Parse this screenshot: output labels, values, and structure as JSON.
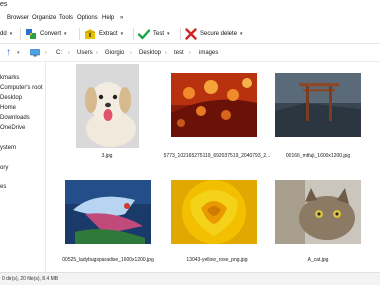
{
  "window": {
    "title": "es"
  },
  "menu": {
    "items": [
      "Browser",
      "Organize",
      "Tools",
      "Options",
      "Help"
    ],
    "overflow": "»"
  },
  "toolbar": {
    "add_label": "dd",
    "convert_label": "Convert",
    "extract_label": "Extract",
    "test_label": "Test",
    "secure_delete_label": "Secure delete",
    "caret": "▾"
  },
  "address": {
    "up_arrow": "↑",
    "drive": "C:",
    "segments": [
      "Users",
      "Giorgio",
      "Desktop",
      "test",
      "images"
    ],
    "separator": "›"
  },
  "sidebar": {
    "items": [
      "kmarks",
      "Computer's root",
      "Desktop",
      "Home",
      "Downloads",
      "OneDrive",
      "ystem",
      "ory",
      "es"
    ]
  },
  "files": [
    {
      "caption": "3.jpg",
      "thumb": "puppy"
    },
    {
      "caption": "5773_102165275119_692037519_2040793_2...",
      "thumb": "droplets"
    },
    {
      "caption": "00166_mtfuji_1600x1200.jpg",
      "thumb": "torii"
    },
    {
      "caption": "00525_ladybugsparadise_1600x1200.jpg",
      "thumb": "ladybug"
    },
    {
      "caption": "13043-yellow_rose_png.jpg",
      "thumb": "rose"
    },
    {
      "caption": "A_cat.jpg",
      "thumb": "cat"
    }
  ],
  "status": {
    "text": "0 dir(s), 20 file(s), 8.4 MB"
  },
  "colors": {
    "accent": "#1e73d2",
    "extract": "#e0b000",
    "test": "#18a34a",
    "delete": "#d32424"
  }
}
